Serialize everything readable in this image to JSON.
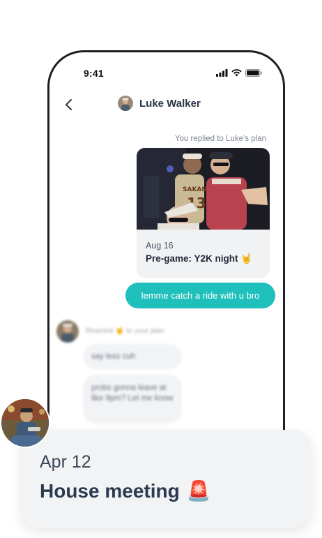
{
  "status_bar": {
    "time": "9:41"
  },
  "chat": {
    "contact_name": "Luke Walker",
    "reply_note": "You replied to Luke’s plan",
    "plan_card": {
      "date": "Aug 16",
      "title": "Pre-game: Y2K night 🤘"
    },
    "sent_message": "lemme catch a ride with u bro",
    "received": {
      "reacted_note": "Reacted 🤘 to your plan",
      "messages": [
        "say less cuh",
        "probs gonna leave at like 9pm? Let me know"
      ]
    }
  },
  "plan_overlay": {
    "date": "Apr 12",
    "title": "House meeting",
    "emoji": "🚨"
  },
  "icons": {
    "back": "chevron-left-icon",
    "signal": "cellular-signal-icon",
    "wifi": "wifi-icon",
    "battery": "battery-icon"
  },
  "colors": {
    "accent": "#1fc0bb",
    "text_dark": "#2c3a4f",
    "card_bg": "#f2f3f5"
  }
}
